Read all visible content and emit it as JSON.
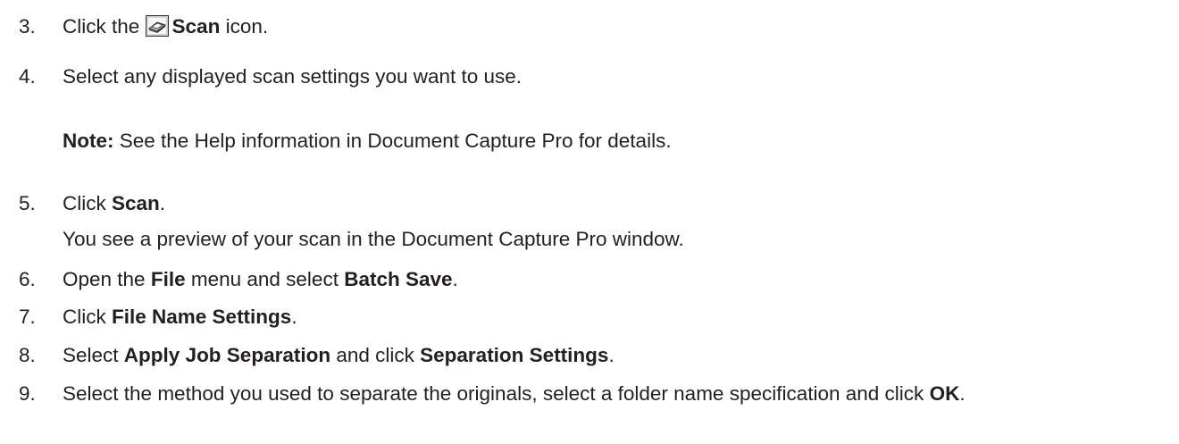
{
  "steps": [
    {
      "num": "3.",
      "pre": "Click the ",
      "icon": "scan-icon",
      "bold": "Scan",
      "post": " icon."
    },
    {
      "num": "4.",
      "text": "Select any displayed scan settings you want to use."
    },
    {
      "note_label": "Note:",
      "note_text": " See the Help information in Document Capture Pro for details."
    },
    {
      "num": "5.",
      "pre": "Click ",
      "bold": "Scan",
      "post": "."
    },
    {
      "sub": "You see a preview of your scan in the Document Capture Pro window."
    },
    {
      "num": "6.",
      "pre": "Open the ",
      "bold1": "File",
      "mid": " menu and select ",
      "bold2": "Batch Save",
      "post": "."
    },
    {
      "num": "7.",
      "pre": "Click ",
      "bold": "File Name Settings",
      "post": "."
    },
    {
      "num": "8.",
      "pre": "Select ",
      "bold1": "Apply Job Separation",
      "mid": " and click ",
      "bold2": "Separation Settings",
      "post": "."
    },
    {
      "num": "9.",
      "text": "Select the method you used to separate the originals, select a folder name specification and click ",
      "bold": "OK",
      "post": "."
    }
  ]
}
